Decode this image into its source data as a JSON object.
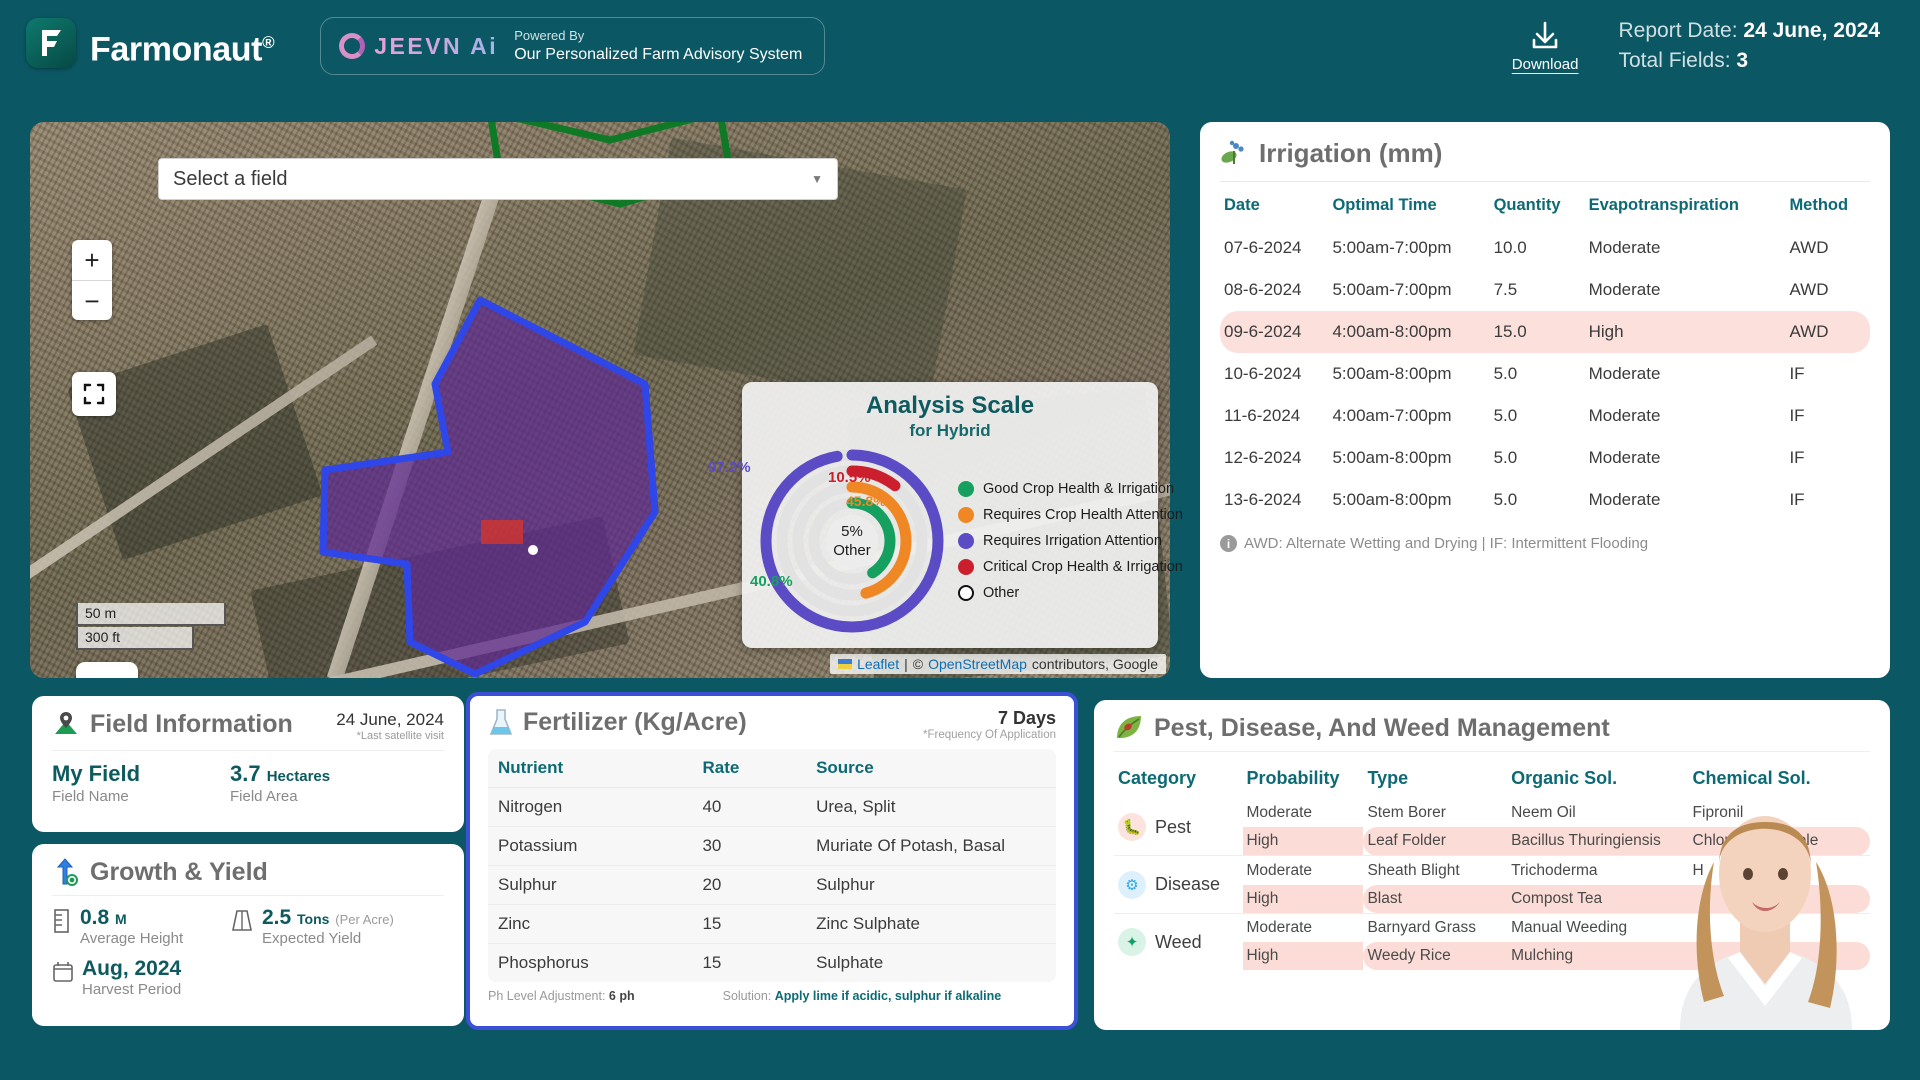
{
  "header": {
    "brand_name": "Farmonaut",
    "brand_reg": "®",
    "jeevn_word": "JEEVN Ai",
    "powered_by": "Powered By",
    "tagline": "Our Personalized Farm Advisory System",
    "download_label": "Download",
    "download_icon": "download-icon",
    "report_date_label": "Report Date: ",
    "report_date_value": "24 June, 2024",
    "total_fields_label": "Total Fields: ",
    "total_fields_value": "3",
    "bg_color": "#0b5763"
  },
  "map": {
    "zoom_in": "+",
    "zoom_out": "−",
    "field_select_value": "Select a field",
    "caret_icon": "chevron-down-icon",
    "fullscreen_icon": "fullscreen-icon",
    "ruler_icon": "ruler-icon",
    "scale_metric": "50 m",
    "scale_imperial": "300 ft",
    "attrib_leaflet": "Leaflet",
    "attrib_sep": "|",
    "attrib_copy": "© ",
    "attrib_osm": "OpenStreetMap",
    "attrib_rest": " contributors, Google"
  },
  "chart_data": {
    "type": "pie",
    "title": "Analysis Scale",
    "subtitle": "for Hybrid",
    "categories": [
      "Good Crop Health & Irrigation",
      "Requires Crop Health Attention",
      "Requires Irrigation Attention",
      "Critical Crop Health & Irrigation",
      "Other"
    ],
    "values": [
      40.8,
      45.8,
      97.2,
      10.5,
      5
    ],
    "labels": [
      "40.8%",
      "45.8%",
      "97.2%",
      "10.5%",
      "5%"
    ],
    "colors": [
      "#16a05f",
      "#ef8724",
      "#5b4bc4",
      "#cc1f2e",
      "#ffffff"
    ],
    "center_value": "5%",
    "center_label": "Other",
    "legend_position": "right",
    "grid": false
  },
  "irrigation": {
    "icon": "seedling-icon",
    "title": "Irrigation (mm)",
    "columns": [
      "Date",
      "Optimal Time",
      "Quantity",
      "Evapotranspiration",
      "Method"
    ],
    "rows": [
      {
        "date": "07-6-2024",
        "time": "5:00am-7:00pm",
        "qty": "10.0",
        "evap": "Moderate",
        "evap_level": "moderate",
        "method": "AWD",
        "highlight": false
      },
      {
        "date": "08-6-2024",
        "time": "5:00am-7:00pm",
        "qty": "7.5",
        "evap": "Moderate",
        "evap_level": "moderate",
        "method": "AWD",
        "highlight": false
      },
      {
        "date": "09-6-2024",
        "time": "4:00am-8:00pm",
        "qty": "15.0",
        "evap": "High",
        "evap_level": "high",
        "method": "AWD",
        "highlight": true
      },
      {
        "date": "10-6-2024",
        "time": "5:00am-8:00pm",
        "qty": "5.0",
        "evap": "Moderate",
        "evap_level": "moderate",
        "method": "IF",
        "highlight": false
      },
      {
        "date": "11-6-2024",
        "time": "4:00am-7:00pm",
        "qty": "5.0",
        "evap": "Moderate",
        "evap_level": "moderate",
        "method": "IF",
        "highlight": false
      },
      {
        "date": "12-6-2024",
        "time": "5:00am-8:00pm",
        "qty": "5.0",
        "evap": "Moderate",
        "evap_level": "moderate",
        "method": "IF",
        "highlight": false
      },
      {
        "date": "13-6-2024",
        "time": "5:00am-8:00pm",
        "qty": "5.0",
        "evap": "Moderate",
        "evap_level": "moderate",
        "method": "IF",
        "highlight": false
      }
    ],
    "footnote": "AWD: Alternate Wetting and Drying | IF: Intermittent Flooding"
  },
  "field_info": {
    "icon": "map-pin-icon",
    "title": "Field Information",
    "date": "24 June, 2024",
    "date_note": "*Last satellite visit",
    "field_name_value": "My Field",
    "field_name_label": "Field Name",
    "field_area_value": "3.7",
    "field_area_unit": "Hectares",
    "field_area_label": "Field Area"
  },
  "growth": {
    "icon": "growth-arrow-icon",
    "title": "Growth & Yield",
    "height_value": "0.8",
    "height_unit": "M",
    "height_label": "Average Height",
    "yield_value": "2.5",
    "yield_unit": "Tons",
    "yield_per": "(Per Acre)",
    "yield_label": "Expected Yield",
    "harvest_value": "Aug, 2024",
    "harvest_label": "Harvest Period"
  },
  "fertilizer": {
    "icon": "flask-icon",
    "title": "Fertilizer (Kg/Acre)",
    "frequency": "7 Days",
    "frequency_note": "*Frequency Of Application",
    "columns": [
      "Nutrient",
      "Rate",
      "Source"
    ],
    "rows": [
      {
        "nutrient": "Nitrogen",
        "rate": "40",
        "source": "Urea, Split"
      },
      {
        "nutrient": "Potassium",
        "rate": "30",
        "source": "Muriate Of Potash, Basal"
      },
      {
        "nutrient": "Sulphur",
        "rate": "20",
        "source": "Sulphur"
      },
      {
        "nutrient": "Zinc",
        "rate": "15",
        "source": "Zinc Sulphate"
      },
      {
        "nutrient": "Phosphorus",
        "rate": "15",
        "source": "Sulphate"
      }
    ],
    "ph_label": "Ph Level Adjustment: ",
    "ph_value": "6 ph",
    "solution_label": "Solution: ",
    "solution_value": "Apply lime if acidic, sulphur if alkaline",
    "border_color": "#3b4fd8"
  },
  "pest": {
    "icon": "leaf-bug-icon",
    "title": "Pest, Disease, And Weed Management",
    "columns": [
      "Category",
      "Probability",
      "Type",
      "Organic Sol.",
      "Chemical Sol."
    ],
    "groups": [
      {
        "category": "Pest",
        "icon": "bug-icon",
        "icon_bg": "#fde3de",
        "icon_color": "#ef5134",
        "rows": [
          {
            "probability": "Moderate",
            "level": "moderate",
            "type": "Stem Borer",
            "organic": "Neem Oil",
            "chemical": "Fipronil",
            "highlight": false
          },
          {
            "probability": "High",
            "level": "high",
            "type": "Leaf Folder",
            "organic": "Bacillus Thuringiensis",
            "chemical": "Chlorantraniliprole",
            "highlight": true
          }
        ]
      },
      {
        "category": "Disease",
        "icon": "virus-icon",
        "icon_bg": "#def0fb",
        "icon_color": "#34a8e0",
        "rows": [
          {
            "probability": "Moderate",
            "level": "moderate",
            "type": "Sheath Blight",
            "organic": "Trichoderma",
            "chemical": "H",
            "highlight": false
          },
          {
            "probability": "High",
            "level": "high",
            "type": "Blast",
            "organic": "Compost Tea",
            "chemical": "",
            "highlight": true
          }
        ]
      },
      {
        "category": "Weed",
        "icon": "sprout-icon",
        "icon_bg": "#d9f3e7",
        "icon_color": "#12a06a",
        "rows": [
          {
            "probability": "Moderate",
            "level": "moderate",
            "type": "Barnyard Grass",
            "organic": "Manual Weeding",
            "chemical": "",
            "highlight": false
          },
          {
            "probability": "High",
            "level": "high",
            "type": "Weedy Rice",
            "organic": "Mulching",
            "chemical": "",
            "highlight": true
          }
        ]
      }
    ]
  },
  "colors": {
    "teal_bg": "#0b5763",
    "teal_accent": "#0d6a74",
    "moderate": "#f5b324",
    "high": "#f2563a",
    "highlight_row": "#fbdcd6"
  }
}
